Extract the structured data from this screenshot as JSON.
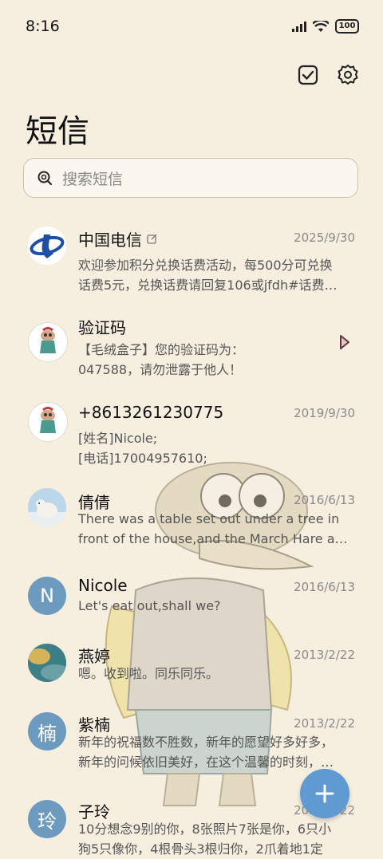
{
  "status": {
    "time": "8:16",
    "battery": "100"
  },
  "header": {
    "title": "短信"
  },
  "search": {
    "placeholder": "搜索短信"
  },
  "messages": [
    {
      "name": "中国电信",
      "date": "2025/9/30",
      "line1": "欢迎参加积分兑换话费活动，每500分可兑换",
      "line2": "话费5元，兑换话费请回复106或jfdh#话费…",
      "avatar": "telecom"
    },
    {
      "name": "验证码",
      "date": "",
      "line1": "【毛绒盒子】您的验证码为：",
      "line2": "047588，请勿泄露于他人！",
      "avatar": "cartoon"
    },
    {
      "name": "+8613261230775",
      "date": "2019/9/30",
      "line1": "[姓名]Nicole;",
      "line2": "[电话]17004957610;",
      "avatar": "cartoon"
    },
    {
      "name": "倩倩",
      "date": "2016/6/13",
      "line1": "There was a table set out under a tree in",
      "line2": "front of the house,and the March Hare an…",
      "avatar": "bear"
    },
    {
      "name": "Nicole",
      "date": "2016/6/13",
      "line1": "Let's eat out,shall we?",
      "line2": "",
      "avatar": "letter",
      "letter": "N"
    },
    {
      "name": "燕婷",
      "date": "2013/2/22",
      "line1": "嗯。收到啦。同乐同乐。",
      "line2": "",
      "avatar": "landscape"
    },
    {
      "name": "紫楠",
      "date": "2013/2/22",
      "line1": "新年的祝福数不胜数，新年的愿望好多好多，",
      "line2": "新年的问候依旧美好，在这个温馨的时刻，…",
      "avatar": "letter",
      "letter": "楠"
    },
    {
      "name": "子玲",
      "date": "2013/2/22",
      "line1": "10分想念9别的你，8张照片7张是你，6只小",
      "line2": "狗5只像你，4根骨头3根归你，2爪着地1定",
      "avatar": "letter",
      "letter": "玲"
    }
  ]
}
